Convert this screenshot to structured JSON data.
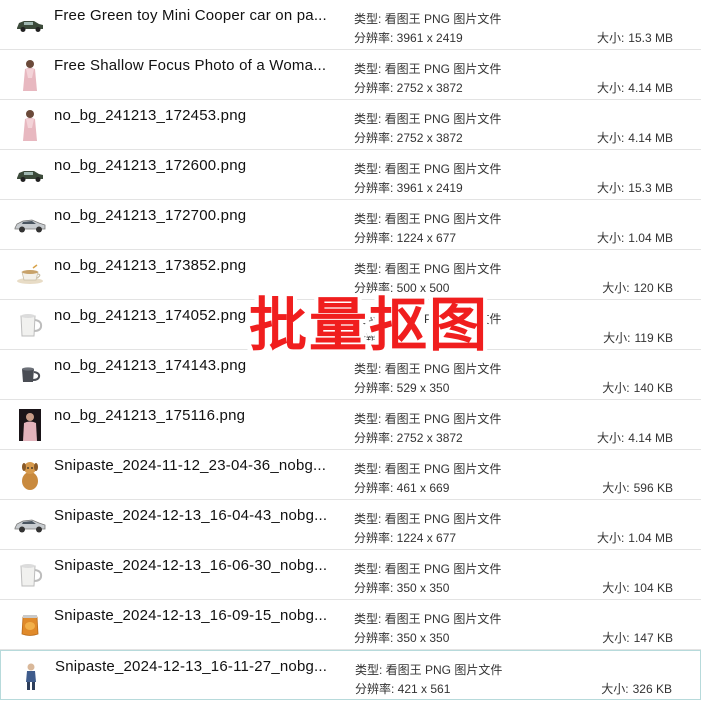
{
  "files": [
    {
      "name": "Free Green toy Mini Cooper car on pa...",
      "type": "类型: 看图王 PNG 图片文件",
      "resolution": "分辨率: 3961 x 2419",
      "size_label": "大小:",
      "size": "15.3 MB",
      "thumb": "green-car-icon"
    },
    {
      "name": "Free Shallow Focus Photo of a Woma...",
      "type": "类型: 看图王 PNG 图片文件",
      "resolution": "分辨率: 2752 x 3872",
      "size_label": "大小:",
      "size": "4.14 MB",
      "thumb": "woman-icon"
    },
    {
      "name": "no_bg_241213_172453.png",
      "type": "类型: 看图王 PNG 图片文件",
      "resolution": "分辨率: 2752 x 3872",
      "size_label": "大小:",
      "size": "4.14 MB",
      "thumb": "woman-icon"
    },
    {
      "name": "no_bg_241213_172600.png",
      "type": "类型: 看图王 PNG 图片文件",
      "resolution": "分辨率: 3961 x 2419",
      "size_label": "大小:",
      "size": "15.3 MB",
      "thumb": "green-car-icon"
    },
    {
      "name": "no_bg_241213_172700.png",
      "type": "类型: 看图王 PNG 图片文件",
      "resolution": "分辨率: 1224 x 677",
      "size_label": "大小:",
      "size": "1.04 MB",
      "thumb": "silver-car-icon"
    },
    {
      "name": "no_bg_241213_173852.png",
      "type": "类型: 看图王 PNG 图片文件",
      "resolution": "分辨率: 500 x 500",
      "size_label": "大小:",
      "size": "120 KB",
      "thumb": "teacup-icon"
    },
    {
      "name": "no_bg_241213_174052.png",
      "type": "类型: 看图王 PNG 图片文件",
      "resolution": "分辨率: 500 x 500",
      "size_label": "大小:",
      "size": "119 KB",
      "thumb": "white-mug-icon"
    },
    {
      "name": "no_bg_241213_174143.png",
      "type": "类型: 看图王 PNG 图片文件",
      "resolution": "分辨率: 529 x 350",
      "size_label": "大小:",
      "size": "140 KB",
      "thumb": "dark-mug-icon"
    },
    {
      "name": "no_bg_241213_175116.png",
      "type": "类型: 看图王 PNG 图片文件",
      "resolution": "分辨率: 2752 x 3872",
      "size_label": "大小:",
      "size": "4.14 MB",
      "thumb": "woman-dark-bg-icon"
    },
    {
      "name": "Snipaste_2024-11-12_23-04-36_nobg...",
      "type": "类型: 看图王 PNG 图片文件",
      "resolution": "分辨率: 461 x 669",
      "size_label": "大小:",
      "size": "596 KB",
      "thumb": "dog-icon"
    },
    {
      "name": "Snipaste_2024-12-13_16-04-43_nobg...",
      "type": "类型: 看图王 PNG 图片文件",
      "resolution": "分辨率: 1224 x 677",
      "size_label": "大小:",
      "size": "1.04 MB",
      "thumb": "silver-car-icon"
    },
    {
      "name": "Snipaste_2024-12-13_16-06-30_nobg...",
      "type": "类型: 看图王 PNG 图片文件",
      "resolution": "分辨率: 350 x 350",
      "size_label": "大小:",
      "size": "104 KB",
      "thumb": "white-mug-icon"
    },
    {
      "name": "Snipaste_2024-12-13_16-09-15_nobg...",
      "type": "类型: 看图王 PNG 图片文件",
      "resolution": "分辨率: 350 x 350",
      "size_label": "大小:",
      "size": "147 KB",
      "thumb": "honey-jar-icon"
    },
    {
      "name": "Snipaste_2024-12-13_16-11-27_nobg...",
      "type": "类型: 看图王 PNG 图片文件",
      "resolution": "分辨率: 421 x 561",
      "size_label": "大小:",
      "size": "326 KB",
      "thumb": "child-icon"
    }
  ],
  "overlay": {
    "text": "批量抠图",
    "color": "#f01e1e"
  },
  "selected_index": 13
}
